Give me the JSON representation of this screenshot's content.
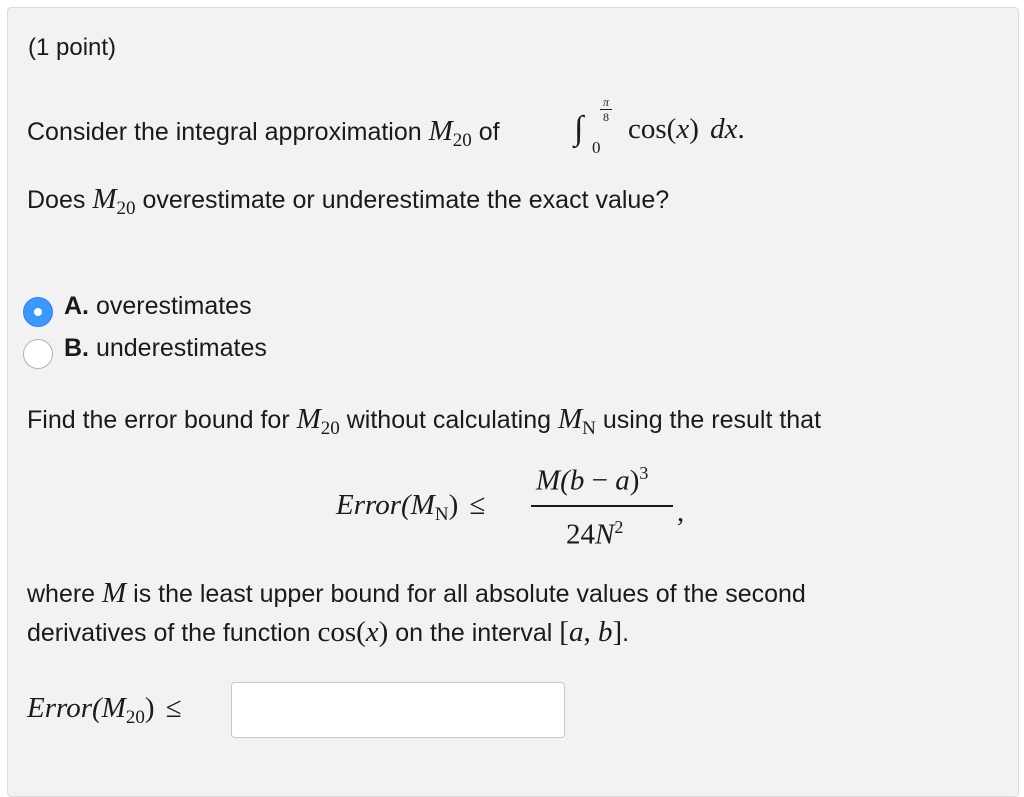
{
  "header": {
    "points": "(1 point)"
  },
  "question": {
    "intro_prefix": "Consider the integral approximation",
    "M": "M",
    "sub20": "20",
    "of": "of",
    "int_lower": "0",
    "int_upper_num": "π",
    "int_upper_den": "8",
    "integrand": "cos(",
    "x": "x",
    "integrand_close": ")",
    "dx": "dx",
    "period": ".",
    "does": "Does",
    "over_under": "overestimate or underestimate the exact value?"
  },
  "choices": [
    {
      "letter": "A.",
      "label": "overestimates",
      "selected": true
    },
    {
      "letter": "B.",
      "label": "underestimates",
      "selected": false
    }
  ],
  "error_bound": {
    "find_prefix": "Find the error bound for",
    "find_mid": "without calculating",
    "find_suffix": "using the result that",
    "N": "N",
    "error_word": "Error(",
    "close": ")",
    "leq": "≤",
    "num_M": "M(",
    "num_b": "b",
    "num_minus": " − ",
    "num_a": "a",
    "num_close": ")",
    "num_exp": "3",
    "den_24": "24",
    "den_N": "N",
    "den_exp": "2",
    "comma": ",",
    "where": "where",
    "where_rest": "is the least upper bound for all absolute values of the second",
    "line2_prefix": "derivatives of the function",
    "cos": "cos(",
    "on_interval": "on the interval",
    "lbr": "[",
    "a": "a",
    "sep": ", ",
    "b": "b",
    "rbr": "]",
    "answer_value": "",
    "answer_placeholder": ""
  }
}
